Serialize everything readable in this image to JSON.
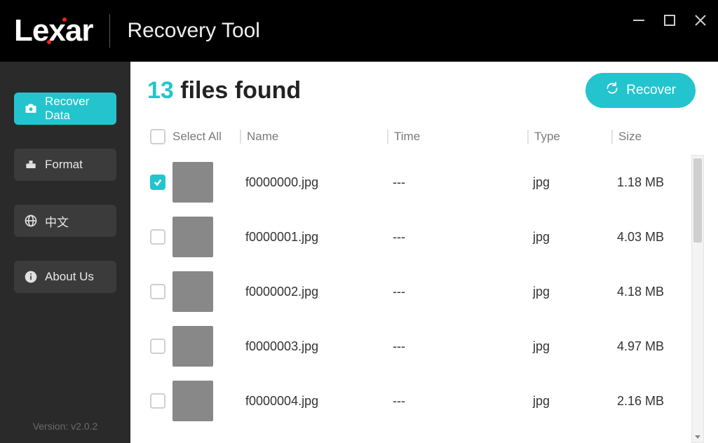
{
  "brand": {
    "name_part1": "Le",
    "name_part2": "x",
    "name_part3": "ar"
  },
  "app_title": "Recovery Tool",
  "window_controls": {
    "minimize": "minimize",
    "maximize": "maximize",
    "close": "close"
  },
  "sidebar": {
    "items": [
      {
        "id": "recover-data",
        "label": "Recover Data",
        "icon": "camera-refresh-icon",
        "active": true
      },
      {
        "id": "format",
        "label": "Format",
        "icon": "drive-icon",
        "active": false
      },
      {
        "id": "language",
        "label": "中文",
        "icon": "globe-icon",
        "active": false
      },
      {
        "id": "about-us",
        "label": "About Us",
        "icon": "info-icon",
        "active": false
      }
    ],
    "version_label": "Version: v2.0.2"
  },
  "main": {
    "found": {
      "count": "13",
      "suffix": "files found"
    },
    "recover_button": "Recover",
    "columns": {
      "select_all": "Select All",
      "name": "Name",
      "time": "Time",
      "type": "Type",
      "size": "Size"
    },
    "rows": [
      {
        "checked": true,
        "thumb": "th0",
        "name": "f0000000.jpg",
        "time": "---",
        "type": "jpg",
        "size": "1.18 MB"
      },
      {
        "checked": false,
        "thumb": "th1",
        "name": "f0000001.jpg",
        "time": "---",
        "type": "jpg",
        "size": "4.03 MB"
      },
      {
        "checked": false,
        "thumb": "th2",
        "name": "f0000002.jpg",
        "time": "---",
        "type": "jpg",
        "size": "4.18 MB"
      },
      {
        "checked": false,
        "thumb": "th3",
        "name": "f0000003.jpg",
        "time": "---",
        "type": "jpg",
        "size": "4.97 MB"
      },
      {
        "checked": false,
        "thumb": "th4",
        "name": "f0000004.jpg",
        "time": "---",
        "type": "jpg",
        "size": "2.16 MB"
      }
    ]
  },
  "accent_color": "#24c4ce"
}
